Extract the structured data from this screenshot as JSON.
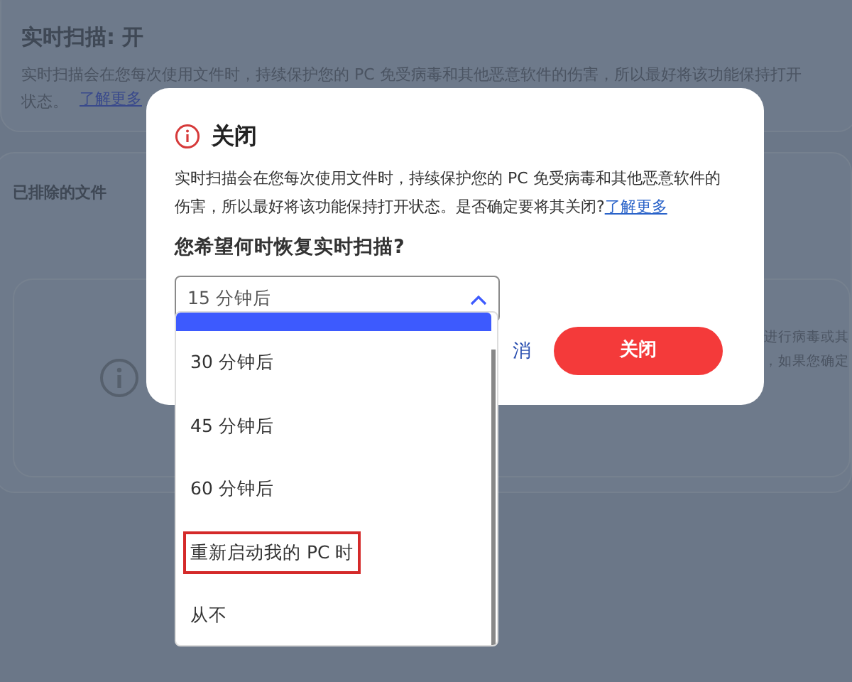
{
  "background": {
    "realtime_card": {
      "title": "实时扫描: 开",
      "description": "实时扫描会在您每次使用文件时，持续保护您的 PC 免受病毒和其他恶意软件的伤害，所以最好将该功能保持打开",
      "description_end": "状态。",
      "link": "了解更多"
    },
    "excluded_card": {
      "title": "已排除的文件",
      "info_lines": [
        "进行病毒或其",
        "，如果您确定"
      ]
    }
  },
  "dialog": {
    "title": "关闭",
    "message": "实时扫描会在您每次使用文件时，持续保护您的 PC 免受病毒和其他恶意软件的伤害，所以最好将该功能保持打开状态。是否确定要将其关闭?",
    "link": "了解更多",
    "question": "您希望何时恢复实时扫描?",
    "select": {
      "value": "15 分钟后",
      "expanded": true
    },
    "dropdown": {
      "current_option_highlight": true,
      "options": [
        {
          "label": "30 分钟后",
          "selected": false,
          "outlined": false
        },
        {
          "label": "45 分钟后",
          "selected": false,
          "outlined": false
        },
        {
          "label": "60 分钟后",
          "selected": false,
          "outlined": false
        },
        {
          "label": "重新启动我的 PC 时",
          "selected": false,
          "outlined": true
        },
        {
          "label": "从不",
          "selected": false,
          "outlined": false
        }
      ]
    },
    "cancel_button": "消",
    "confirm_button": "关闭"
  }
}
